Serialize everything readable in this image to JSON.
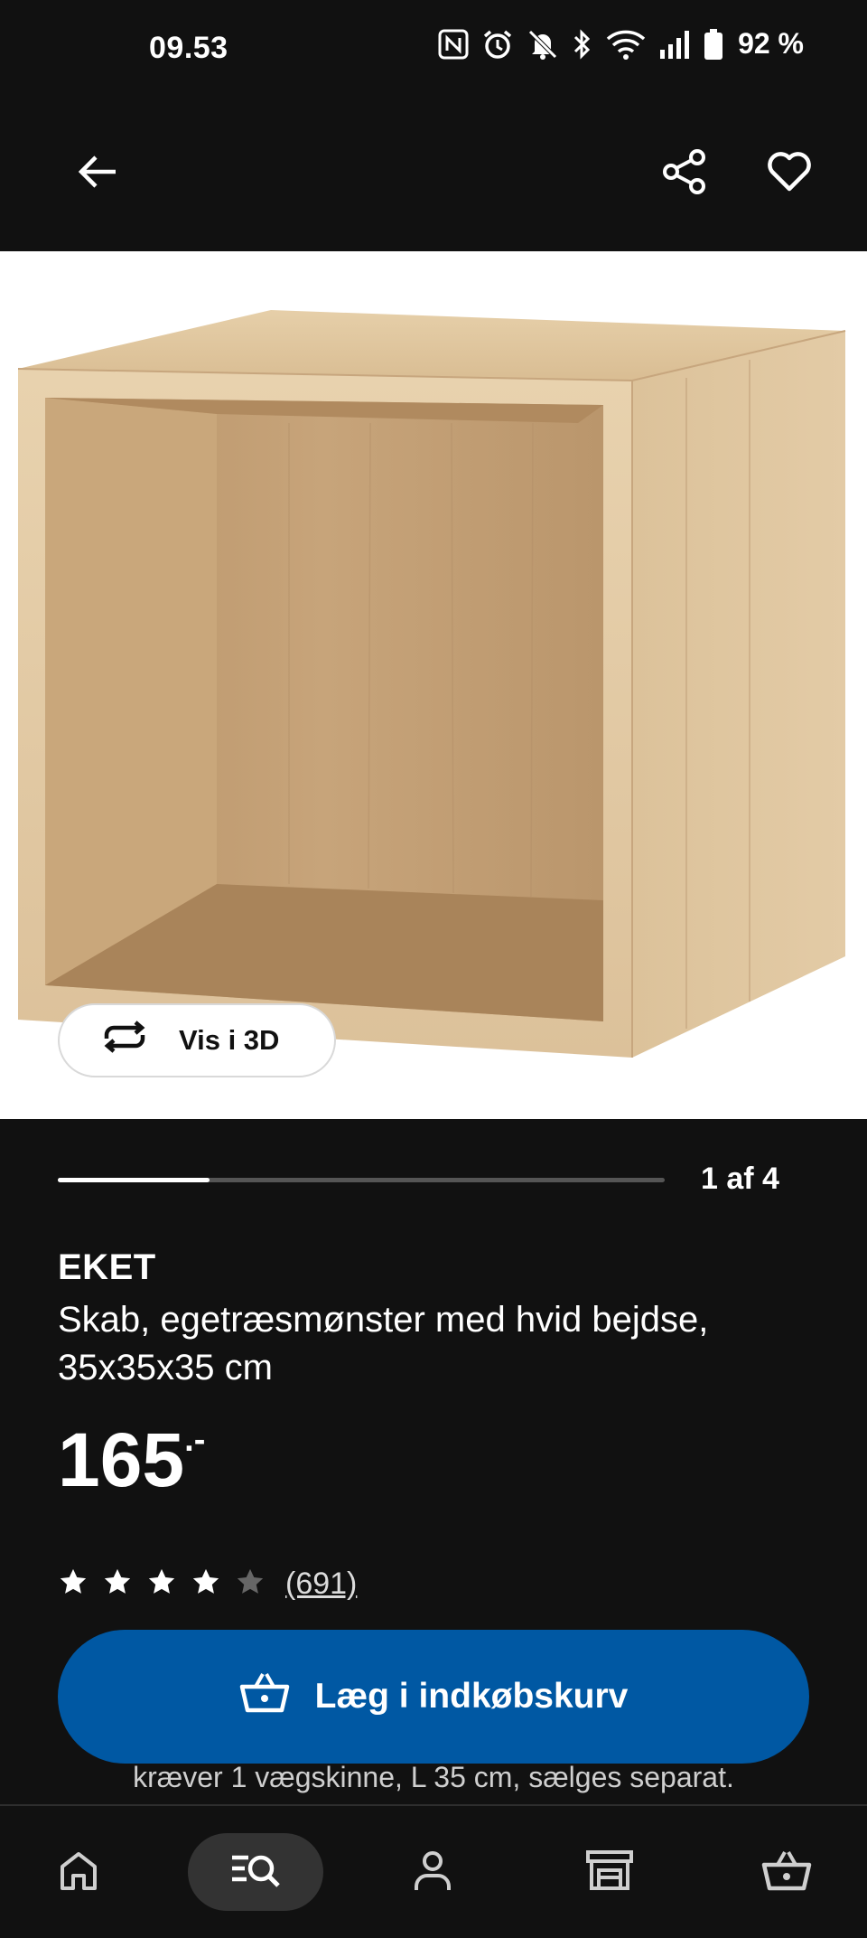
{
  "status_bar": {
    "time": "09.53",
    "battery": "92 %",
    "icons": [
      "nfc-icon",
      "alarm-icon",
      "mute-icon",
      "bluetooth-icon",
      "wifi-icon",
      "signal-icon",
      "battery-icon"
    ]
  },
  "app_bar": {
    "back_icon": "arrow-left-icon",
    "share_icon": "share-icon",
    "favorite_icon": "heart-icon"
  },
  "gallery": {
    "view_3d_label": "Vis i 3D",
    "pager": "1 af 4",
    "current": 1,
    "total": 4,
    "progress_fraction": 0.25
  },
  "product": {
    "name": "EKET",
    "description": "Skab, egetræsmønster med hvid bejdse, 35x35x35 cm",
    "price": "165",
    "price_suffix": ".-",
    "rating": 4,
    "rating_max": 5,
    "review_count": "(691)"
  },
  "cta": {
    "add_to_cart_label": "Læg i indkøbskurv"
  },
  "note": "kræver 1 vægskinne, L 35 cm, sælges separat.",
  "bottom_nav": {
    "items": [
      {
        "name": "home",
        "icon": "home-icon"
      },
      {
        "name": "search",
        "icon": "search-list-icon",
        "active": true
      },
      {
        "name": "profile",
        "icon": "person-icon"
      },
      {
        "name": "stores",
        "icon": "store-icon"
      },
      {
        "name": "cart",
        "icon": "basket-icon"
      }
    ]
  },
  "colors": {
    "background": "#111111",
    "accent": "#0058a3",
    "text": "#ffffff"
  }
}
